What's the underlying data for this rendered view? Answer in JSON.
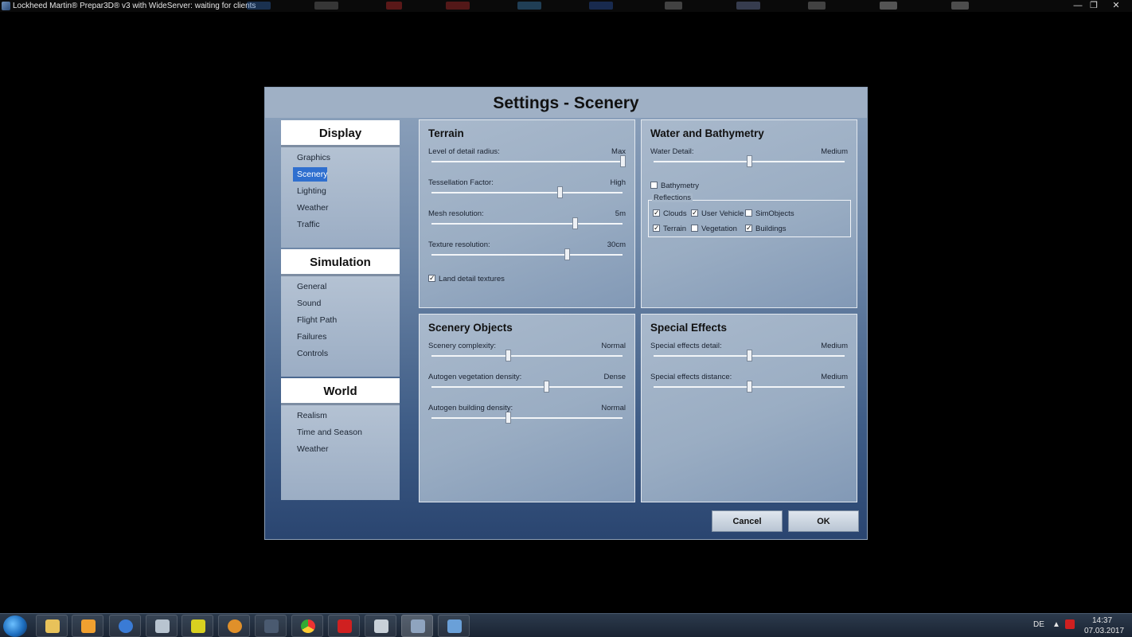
{
  "window": {
    "title": "Lockheed Martin® Prepar3D® v3 with WideServer: waiting for clients",
    "buttons": {
      "minimize": "—",
      "restore": "❐",
      "close": "✕"
    }
  },
  "dialog": {
    "title": "Settings - Scenery",
    "nav": [
      {
        "header": "Display",
        "items": [
          "Graphics",
          "Scenery",
          "Lighting",
          "Weather",
          "Traffic"
        ],
        "selected": "Scenery"
      },
      {
        "header": "Simulation",
        "items": [
          "General",
          "Sound",
          "Flight Path",
          "Failures",
          "Controls"
        ]
      },
      {
        "header": "World",
        "items": [
          "Realism",
          "Time and Season",
          "Weather"
        ]
      }
    ],
    "panels": {
      "terrain": {
        "title": "Terrain",
        "sliders": [
          {
            "label": "Level of detail radius:",
            "value": "Max",
            "level": 1.0
          },
          {
            "label": "Tessellation Factor:",
            "value": "High",
            "level": 0.67
          },
          {
            "label": "Mesh resolution:",
            "value": "5m",
            "level": 0.75
          },
          {
            "label": "Texture resolution:",
            "value": "30cm",
            "level": 0.71
          }
        ],
        "checkbox": {
          "label": "Land detail textures",
          "checked": true
        }
      },
      "water": {
        "title": "Water and Bathymetry",
        "sliders": [
          {
            "label": "Water Detail:",
            "value": "Medium",
            "level": 0.5
          }
        ],
        "bathymetry": {
          "label": "Bathymetry",
          "checked": false
        },
        "reflections": {
          "legend": "Reflections",
          "items": [
            {
              "label": "Clouds",
              "checked": true
            },
            {
              "label": "User Vehicle",
              "checked": true
            },
            {
              "label": "SimObjects",
              "checked": false
            },
            {
              "label": "Terrain",
              "checked": true
            },
            {
              "label": "Vegetation",
              "checked": false
            },
            {
              "label": "Buildings",
              "checked": true
            }
          ]
        }
      },
      "scenery_objects": {
        "title": "Scenery Objects",
        "sliders": [
          {
            "label": "Scenery complexity:",
            "value": "Normal",
            "level": 0.4
          },
          {
            "label": "Autogen vegetation density:",
            "value": "Dense",
            "level": 0.6
          },
          {
            "label": "Autogen building density:",
            "value": "Normal",
            "level": 0.4
          }
        ]
      },
      "special_effects": {
        "title": "Special Effects",
        "sliders": [
          {
            "label": "Special effects detail:",
            "value": "Medium",
            "level": 0.5
          },
          {
            "label": "Special effects distance:",
            "value": "Medium",
            "level": 0.5
          }
        ]
      }
    },
    "buttons": {
      "cancel": "Cancel",
      "ok": "OK"
    }
  },
  "taskbar": {
    "icons": [
      "explorer",
      "media-player",
      "globe",
      "calculator",
      "tool-99",
      "compass",
      "asig",
      "chrome",
      "64",
      "plane",
      "p3d",
      "monitor"
    ],
    "language": "DE",
    "time": "14:37",
    "date": "07.03.2017"
  }
}
